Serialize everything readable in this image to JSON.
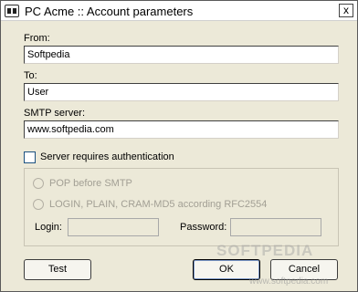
{
  "window": {
    "title": "PC Acme :: Account parameters",
    "close_glyph": "x"
  },
  "form": {
    "from": {
      "label": "From:",
      "value": "Softpedia"
    },
    "to": {
      "label": "To:",
      "value": "User"
    },
    "smtp": {
      "label": "SMTP server:",
      "value": "www.softpedia.com"
    },
    "auth_checkbox": {
      "label": "Server requires authentication",
      "checked": false
    }
  },
  "auth_group": {
    "option_pop": "POP before SMTP",
    "option_login": "LOGIN, PLAIN, CRAM-MD5 according RFC2554",
    "login_label": "Login:",
    "login_value": "",
    "password_label": "Password:",
    "password_value": ""
  },
  "buttons": {
    "test": "Test",
    "ok": "OK",
    "cancel": "Cancel"
  },
  "watermark": {
    "brand": "SOFTPEDIA",
    "url": "www.softpedia.com"
  }
}
